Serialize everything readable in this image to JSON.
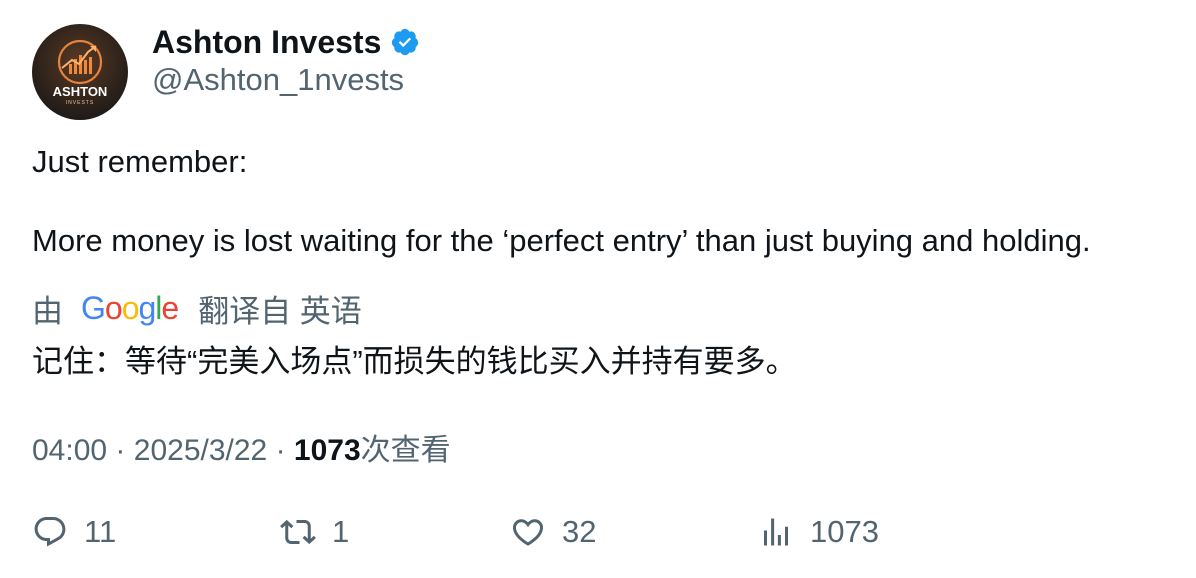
{
  "author": {
    "display_name": "Ashton Invests",
    "handle": "@Ashton_1nvests",
    "verified": true,
    "avatar_text": "ASHTON",
    "avatar_subtext": "INVESTS"
  },
  "tweet": {
    "line1": "Just remember:",
    "line2": "More money is lost waiting for the ‘perfect entry’ than just buying and holding."
  },
  "translation": {
    "prefix": "由",
    "provider": "Google",
    "suffix": "翻译自 英语",
    "text": "记住：等待“完美入场点”而损失的钱比买入并持有要多。"
  },
  "meta": {
    "time": "04:00",
    "date": "2025/3/22",
    "separator": "·",
    "views_count": "1073",
    "views_label": "次查看"
  },
  "actions": {
    "replies": "11",
    "retweets": "1",
    "likes": "32",
    "views": "1073"
  },
  "colors": {
    "text_primary": "#0f1419",
    "text_secondary": "#536471",
    "verified_blue": "#1d9bf0"
  }
}
